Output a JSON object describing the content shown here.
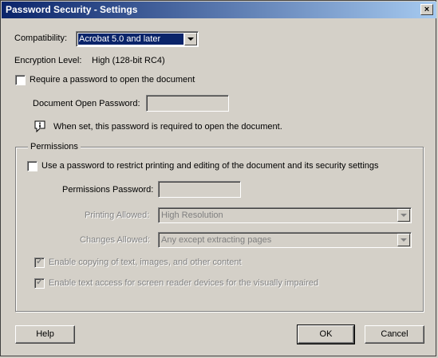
{
  "window": {
    "title": "Password Security - Settings",
    "close_glyph": "×"
  },
  "compatibility": {
    "label": "Compatibility:",
    "value": "Acrobat 5.0 and later"
  },
  "encryption": {
    "label": "Encryption  Level:",
    "value": "High (128-bit RC4)"
  },
  "open_password": {
    "checkbox_label": "Require a password to open the document",
    "checked": false,
    "field_label": "Document Open Password:",
    "field_value": "",
    "info_text": "When set, this password is required to open the document."
  },
  "permissions": {
    "group_title": "Permissions",
    "checkbox_label": "Use a password to restrict printing and editing of the document and its security settings",
    "checked": false,
    "password_label": "Permissions Password:",
    "password_value": "",
    "printing_label": "Printing Allowed:",
    "printing_value": "High Resolution",
    "changes_label": "Changes Allowed:",
    "changes_value": "Any except extracting pages",
    "copy_label": "Enable copying of text, images, and other content",
    "copy_checked": true,
    "screenreader_label": "Enable text access for screen reader devices for the visually impaired",
    "screenreader_checked": true
  },
  "buttons": {
    "help": "Help",
    "ok": "OK",
    "cancel": "Cancel"
  },
  "colors": {
    "titlebar_start": "#0a246a",
    "titlebar_end": "#a6caf0",
    "dialog_bg": "#d4d0c8",
    "selection": "#0a246a"
  },
  "icons": {
    "info": "info-icon",
    "close": "close-icon",
    "dropdown": "chevron-down-icon"
  }
}
